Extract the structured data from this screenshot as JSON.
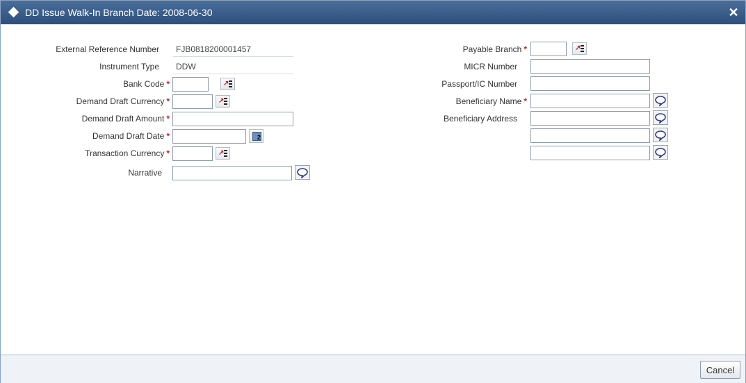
{
  "window": {
    "title": "DD Issue Walk-In  Branch Date: 2008-06-30",
    "close_symbol": "✕"
  },
  "form_left": {
    "external_reference_number": {
      "label": "External Reference Number",
      "value": "FJB0818200001457"
    },
    "instrument_type": {
      "label": "Instrument Type",
      "value": "DDW"
    },
    "bank_code": {
      "label": "Bank Code",
      "value": ""
    },
    "demand_draft_currency": {
      "label": "Demand Draft Currency",
      "value": ""
    },
    "demand_draft_amount": {
      "label": "Demand Draft Amount",
      "value": ""
    },
    "demand_draft_date": {
      "label": "Demand Draft Date",
      "value": ""
    },
    "transaction_currency": {
      "label": "Transaction Currency",
      "value": ""
    },
    "narrative": {
      "label": "Narrative",
      "value": ""
    }
  },
  "form_right": {
    "payable_branch": {
      "label": "Payable Branch",
      "value": ""
    },
    "micr_number": {
      "label": "MICR Number",
      "value": ""
    },
    "passport_ic_number": {
      "label": "Passport/IC Number",
      "value": ""
    },
    "beneficiary_name": {
      "label": "Beneficiary Name",
      "value": ""
    },
    "beneficiary_address": {
      "label": "Beneficiary Address",
      "lines": [
        "",
        "",
        ""
      ]
    }
  },
  "required_marker": "*",
  "calendar_day": "2",
  "icons": {
    "lov": "list-of-values-icon",
    "calendar": "calendar-icon",
    "text_editor": "speech-bubble-icon"
  },
  "footer": {
    "cancel_label": "Cancel"
  },
  "colors": {
    "titlebar": "#3a5d8c",
    "required": "#d21c1c",
    "footer_bg": "#eff2f6"
  }
}
